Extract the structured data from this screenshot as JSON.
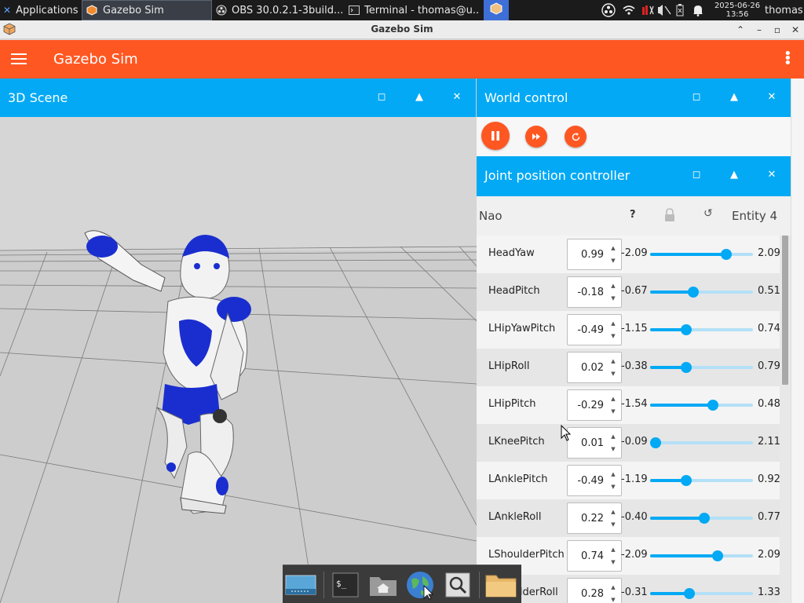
{
  "taskbar": {
    "apps_menu_label": "Applications",
    "tasks": [
      {
        "label": "Gazebo Sim"
      },
      {
        "label": "OBS 30.0.2.1-3build..."
      },
      {
        "label": "Terminal - thomas@u..."
      }
    ],
    "clock_date": "2025-06-26",
    "clock_time": "13:56",
    "user": "thomas"
  },
  "window": {
    "title": "Gazebo Sim"
  },
  "appbar": {
    "title": "Gazebo Sim"
  },
  "scene_panel": {
    "title": "3D Scene"
  },
  "world_control": {
    "title": "World control"
  },
  "joint_controller": {
    "title": "Joint position controller",
    "model_name": "Nao",
    "help_label": "?",
    "entity_label": "Entity 4",
    "joints": [
      {
        "name": "HeadYaw",
        "value": "0.99",
        "min": "-2.09",
        "max": "2.09",
        "fraction": 0.74
      },
      {
        "name": "HeadPitch",
        "value": "-0.18",
        "min": "-0.67",
        "max": "0.51",
        "fraction": 0.42
      },
      {
        "name": "LHipYawPitch",
        "value": "-0.49",
        "min": "-1.15",
        "max": "0.74",
        "fraction": 0.35
      },
      {
        "name": "LHipRoll",
        "value": "0.02",
        "min": "-0.38",
        "max": "0.79",
        "fraction": 0.35
      },
      {
        "name": "LHipPitch",
        "value": "-0.29",
        "min": "-1.54",
        "max": "0.48",
        "fraction": 0.61
      },
      {
        "name": "LKneePitch",
        "value": "0.01",
        "min": "-0.09",
        "max": "2.11",
        "fraction": 0.05
      },
      {
        "name": "LAnklePitch",
        "value": "-0.49",
        "min": "-1.19",
        "max": "0.92",
        "fraction": 0.35
      },
      {
        "name": "LAnkleRoll",
        "value": "0.22",
        "min": "-0.40",
        "max": "0.77",
        "fraction": 0.53
      },
      {
        "name": "LShoulderPitch",
        "value": "0.74",
        "min": "-2.09",
        "max": "2.09",
        "fraction": 0.66
      },
      {
        "name": "LShoulderRoll",
        "value": "0.28",
        "min": "-0.31",
        "max": "1.33",
        "fraction": 0.38
      }
    ]
  },
  "colors": {
    "appbar": "#ff5722",
    "panel_header": "#03a9f4",
    "slider_track": "#b3e0f7",
    "taskbar": "#1b1b1b"
  },
  "icons": {
    "menu": "hamburger-icon",
    "overflow": "kebab-icon",
    "pause": "pause-icon",
    "step": "fast-forward-icon",
    "reset": "refresh-icon",
    "lock": "lock-icon"
  }
}
